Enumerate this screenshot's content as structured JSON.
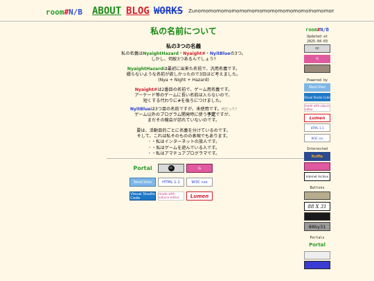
{
  "header": {
    "logo_room": "room",
    "logo_hash": "#",
    "logo_nb": "N/B",
    "nav_about": "ABOUT",
    "nav_blog": "BLOG",
    "nav_works": "WORKS",
    "marquee": "Zunomomomomomomomomomomomomomomomomomomomomomomoooomoomomo"
  },
  "main": {
    "title": "私の名前について",
    "subtitle": "私の3つの名義",
    "p1_l1_a": "私の名義は",
    "p1_l1_g": "NyaightHazard",
    "p1_l1_dot1": "・",
    "p1_l1_r": "Nyaight#",
    "p1_l1_dot2": "・",
    "p1_l1_b": "NyitBlue",
    "p1_l1_c": "の3つ。",
    "p1_l2": "しかし、何故3つあるんでしょう?",
    "p2_g": "NyaightHazard",
    "p2_l1": "は最初に出来た名前で、汎用名義です。",
    "p2_l2": "綴らないような名前が欲しかったので3日ほど考えました。",
    "p2_l3": "(Nya + Night + Hazard)",
    "p3_r": "Nyaight#",
    "p3_l1": "は2番目の名前で、ゲーム用名義です。",
    "p3_l2": "アーケード等のゲームに長い名前は入らないので、",
    "p3_l3": "短くする代わりに#を後ろにつけました。",
    "p4_b": "NyitBlue",
    "p4_l1": "は3つ目の名前ですが、未使用です。",
    "p4_small": "何だって?",
    "p4_l2a": "ゲーム以外のプログラム開発時に使う",
    "p4_l2b": "予定",
    "p4_l2c": "ですが、",
    "p4_l3": "まだその機会が訪れていないのです。",
    "p5_l1": "要は、活動目的ごとに名義を分けているのです。",
    "p5_l2": "そして、これは私そのものの表現でもあります。",
    "p5_l3": "・私はインターネットの旅人です。",
    "p5_l4": "・私はゲームを遊んでいる人です。",
    "p5_l5": "・私はアマチュアプログラマです。"
  },
  "badges": {
    "portal": "Portal",
    "cc": "cc",
    "g": "G",
    "neocities": "NeoCities",
    "html": "HTML 1.1",
    "css": "W3C css",
    "vscode": "Visual Studio Code",
    "sakura": "made with sakura editor",
    "lumen": "Lumen"
  },
  "sidebar": {
    "updated_label": "Updated at",
    "updated_date": "2025-04-03",
    "powered_by": "Powered by",
    "interested": "Interested",
    "buttons": "Buttons",
    "portals": "Portals",
    "ruffle": "Ruffle",
    "archive": "Internet Archive",
    "b88x31": "88 X 31",
    "b88by31": "88by31",
    "portal": "Portal"
  },
  "colors": {
    "bg": "#fff8e6",
    "green": "#1f8c1f",
    "red": "#d21c2c",
    "blue": "#2640d0"
  }
}
